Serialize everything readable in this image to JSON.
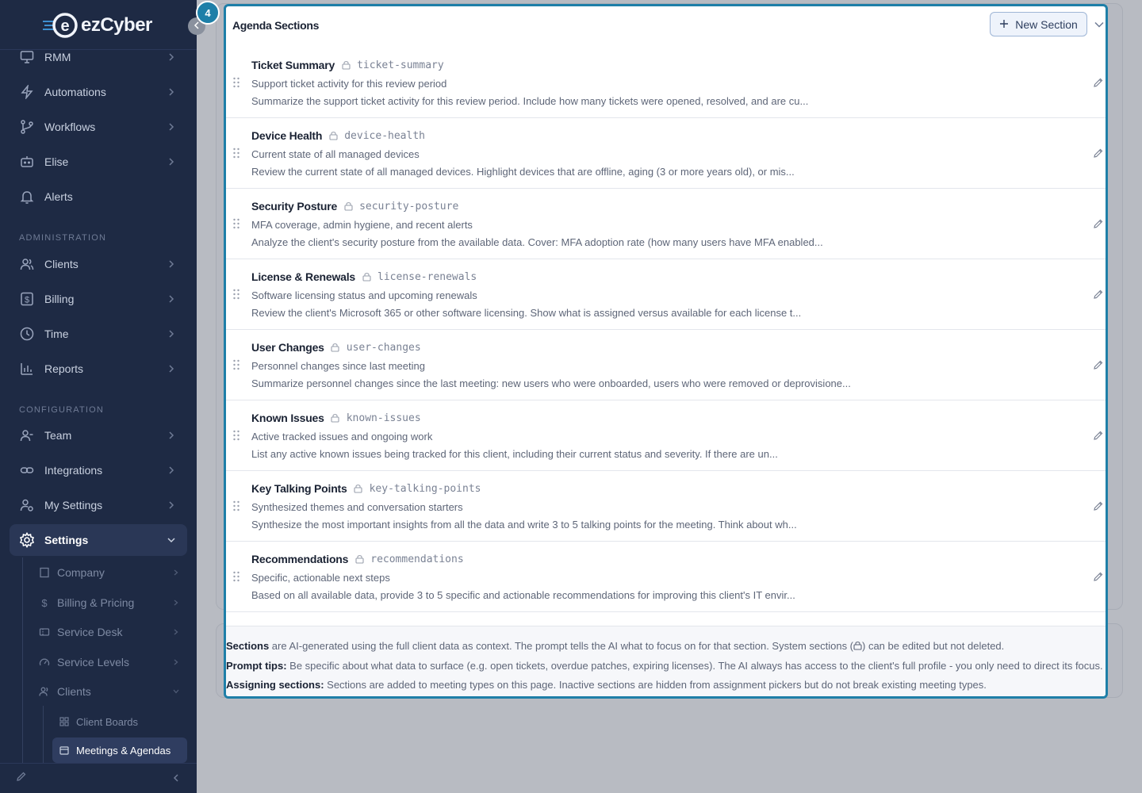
{
  "app": {
    "brand": "ezCyber",
    "logo_letter": "e"
  },
  "sidebar": {
    "items_top": [
      {
        "label": "RMM",
        "icon": "monitor-icon"
      },
      {
        "label": "Automations",
        "icon": "lightning-icon"
      },
      {
        "label": "Workflows",
        "icon": "git-branch-icon"
      },
      {
        "label": "Elise",
        "icon": "bot-icon"
      },
      {
        "label": "Alerts",
        "icon": "bell-icon"
      }
    ],
    "admin_label": "ADMINISTRATION",
    "items_admin": [
      {
        "label": "Clients",
        "icon": "users-icon"
      },
      {
        "label": "Billing",
        "icon": "dollar-icon"
      },
      {
        "label": "Time",
        "icon": "clock-icon"
      },
      {
        "label": "Reports",
        "icon": "bar-chart-icon"
      }
    ],
    "config_label": "CONFIGURATION",
    "items_config": [
      {
        "label": "Team",
        "icon": "team-icon"
      },
      {
        "label": "Integrations",
        "icon": "link-icon"
      },
      {
        "label": "My Settings",
        "icon": "user-cog-icon"
      },
      {
        "label": "Settings",
        "icon": "gear-icon"
      }
    ],
    "settings_sub": [
      {
        "label": "Company"
      },
      {
        "label": "Billing & Pricing"
      },
      {
        "label": "Service Desk"
      },
      {
        "label": "Service Levels"
      },
      {
        "label": "Clients"
      }
    ],
    "clients_sub": [
      {
        "label": "Client Boards"
      },
      {
        "label": "Meetings & Agendas"
      }
    ]
  },
  "tour": {
    "step": "4"
  },
  "panel": {
    "title": "Agenda Sections",
    "new_button": "New Section",
    "sections": [
      {
        "name": "Ticket Summary",
        "slug": "ticket-summary",
        "description": "Support ticket activity for this review period",
        "prompt": "Summarize the support ticket activity for this review period. Include how many tickets were opened, resolved, and are cu..."
      },
      {
        "name": "Device Health",
        "slug": "device-health",
        "description": "Current state of all managed devices",
        "prompt": "Review the current state of all managed devices. Highlight devices that are offline, aging (3 or more years old), or mis..."
      },
      {
        "name": "Security Posture",
        "slug": "security-posture",
        "description": "MFA coverage, admin hygiene, and recent alerts",
        "prompt": "Analyze the client's security posture from the available data. Cover: MFA adoption rate (how many users have MFA enabled..."
      },
      {
        "name": "License & Renewals",
        "slug": "license-renewals",
        "description": "Software licensing status and upcoming renewals",
        "prompt": "Review the client's Microsoft 365 or other software licensing. Show what is assigned versus available for each license t..."
      },
      {
        "name": "User Changes",
        "slug": "user-changes",
        "description": "Personnel changes since last meeting",
        "prompt": "Summarize personnel changes since the last meeting: new users who were onboarded, users who were removed or deprovisione..."
      },
      {
        "name": "Known Issues",
        "slug": "known-issues",
        "description": "Active tracked issues and ongoing work",
        "prompt": "List any active known issues being tracked for this client, including their current status and severity. If there are un..."
      },
      {
        "name": "Key Talking Points",
        "slug": "key-talking-points",
        "description": "Synthesized themes and conversation starters",
        "prompt": "Synthesize the most important insights from all the data and write 3 to 5 talking points for the meeting. Think about wh..."
      },
      {
        "name": "Recommendations",
        "slug": "recommendations",
        "description": "Specific, actionable next steps",
        "prompt": "Based on all available data, provide 3 to 5 specific and actionable recommendations for improving this client's IT envir..."
      }
    ],
    "info": {
      "line1_bold": "Sections",
      "line1_a": " are AI-generated using the full client data as context. The prompt tells the AI what to focus on for that section. System sections (",
      "line1_b": ") can be edited but not deleted.",
      "line2_bold": "Prompt tips:",
      "line2": " Be specific about what data to surface (e.g. open tickets, overdue patches, expiring licenses). The AI always has access to the client's full profile - you only need to direct its focus.",
      "line3_bold": "Assigning sections:",
      "line3": " Sections are added to meeting types on this page. Inactive sections are hidden from assignment pickers but do not break existing meeting types."
    }
  },
  "colors": {
    "sidebar_bg": "#1e2a44",
    "accent": "#1e7fa8",
    "overlay": "#b8bbc2"
  }
}
